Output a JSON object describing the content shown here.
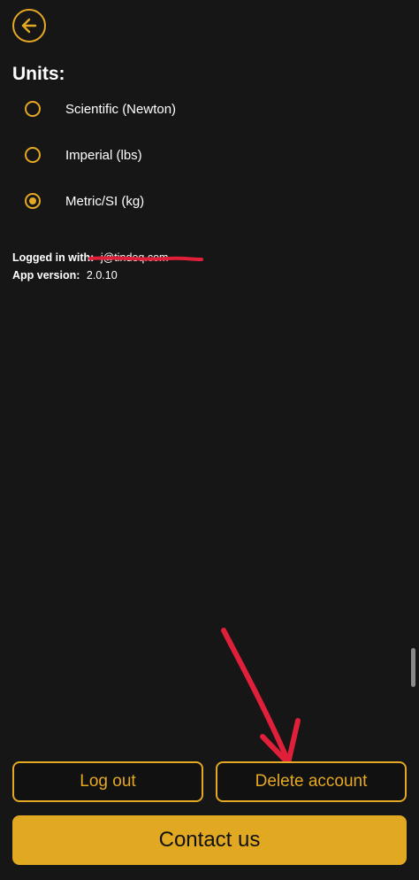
{
  "header": {
    "back_icon": "arrow-left-icon"
  },
  "units": {
    "title": "Units:",
    "options": [
      {
        "label": "Scientific (Newton)",
        "selected": false
      },
      {
        "label": "Imperial (lbs)",
        "selected": false
      },
      {
        "label": "Metric/SI (kg)",
        "selected": true
      }
    ]
  },
  "account_info": {
    "logged_in_label": "Logged in with:",
    "logged_in_value": "j@tindeq.com",
    "app_version_label": "App version:",
    "app_version_value": "2.0.10"
  },
  "actions": {
    "logout_label": "Log out",
    "delete_label": "Delete account",
    "contact_label": "Contact us"
  },
  "colors": {
    "accent": "#E5A823",
    "background": "#161616",
    "annotation": "#E0203A"
  }
}
